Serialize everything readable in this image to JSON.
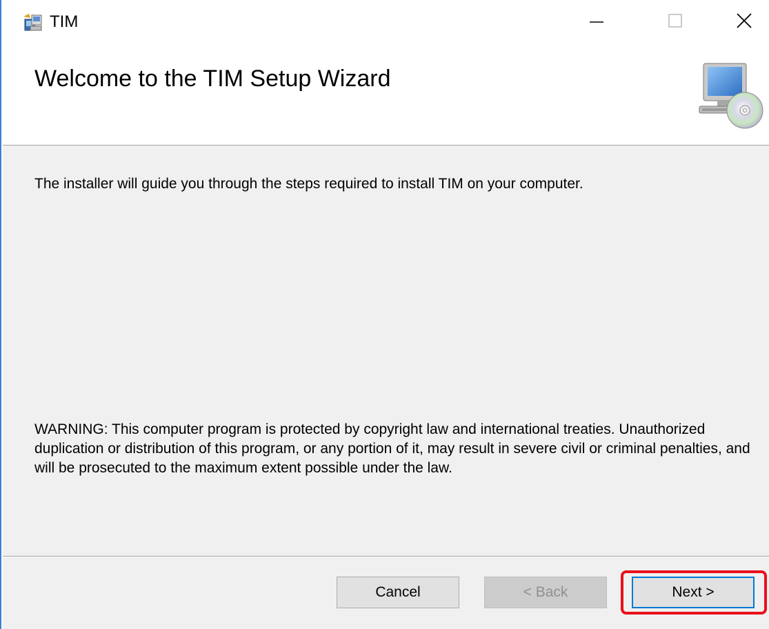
{
  "window": {
    "title": "TIM",
    "controls": {
      "minimize_icon": "minimize-icon",
      "maximize_icon": "maximize-icon",
      "close_icon": "close-icon"
    }
  },
  "banner": {
    "title": "Welcome to the TIM Setup Wizard",
    "image_icon": "computer-cd-icon"
  },
  "content": {
    "intro": "The installer will guide you through the steps required to install TIM on your computer.",
    "warning": "WARNING: This computer program is protected by copyright law and international treaties. Unauthorized duplication or distribution of this program, or any portion of it, may result in severe civil or criminal penalties, and will be prosecuted to the maximum extent possible under the law."
  },
  "buttons": {
    "cancel": "Cancel",
    "back": "< Back",
    "next": "Next >"
  },
  "colors": {
    "accent": "#0078d7",
    "highlight": "#e8101c",
    "panel_bg": "#f0f0f0"
  }
}
